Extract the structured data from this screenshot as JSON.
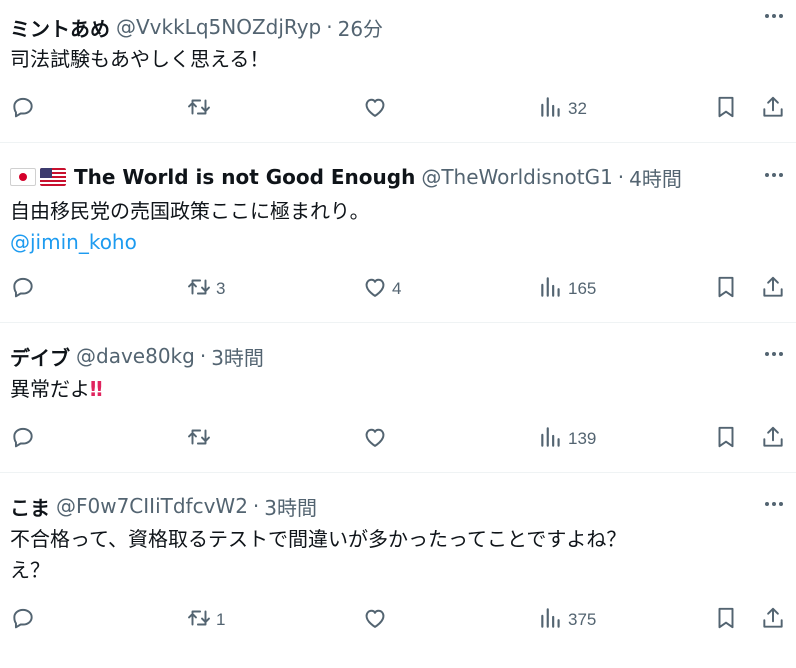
{
  "tweets": [
    {
      "name": "ミントあめ",
      "handle": "@VvkkLq5NOZdjRyp",
      "separator": "·",
      "time": "26分",
      "lines": [
        "司法試験もあやしく思える！"
      ],
      "mention": "",
      "replies": "",
      "retweets": "",
      "likes": "",
      "views": "32"
    },
    {
      "name": "The World is not Good Enough",
      "handle": "@TheWorldisnotG1",
      "separator": "·",
      "time": "4時間",
      "lines": [
        "自由移民党の売国政策ここに極まれり。"
      ],
      "mention": "@jimin_koho",
      "replies": "",
      "retweets": "3",
      "likes": "4",
      "views": "165"
    },
    {
      "name": "デイブ",
      "handle": "@dave80kg",
      "separator": "·",
      "time": "3時間",
      "lines": [
        "異常だよ"
      ],
      "mention": "",
      "replies": "",
      "retweets": "",
      "likes": "",
      "views": "139"
    },
    {
      "name": "こま",
      "handle": "@F0w7CIIiTdfcvW2",
      "separator": "·",
      "time": "3時間",
      "lines": [
        "不合格って、資格取るテストで間違いが多かったってことですよね？",
        "え？"
      ],
      "mention": "",
      "replies": "",
      "retweets": "1",
      "likes": "",
      "views": "375"
    }
  ],
  "emoji": {
    "double_exclamation": "‼",
    "flags": [
      "japan-flag",
      "usa-flag"
    ]
  },
  "icons": {
    "more": "more-dots-icon",
    "reply": "reply-icon",
    "retweet": "retweet-icon",
    "like": "heart-icon",
    "views": "views-bar-chart-icon",
    "bookmark": "bookmark-icon",
    "share": "share-icon"
  },
  "colors": {
    "text": "#0f1419",
    "secondary": "#536471",
    "link": "#1d9bf0",
    "divider": "#eff3f4",
    "emoji_red": "#e0245e"
  }
}
